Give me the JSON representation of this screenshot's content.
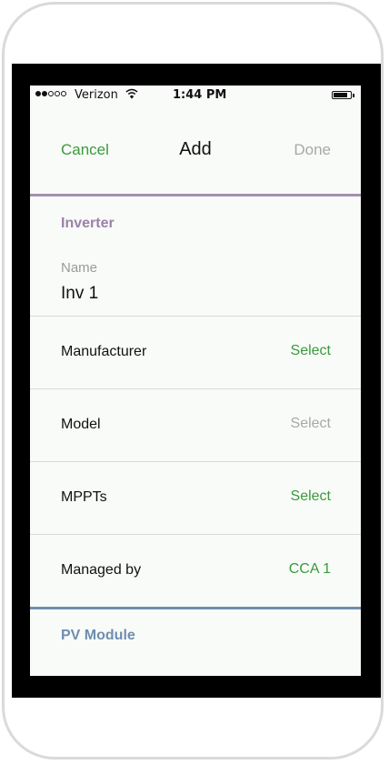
{
  "status_bar": {
    "carrier": "Verizon",
    "time": "1:44 PM",
    "signal_bars_filled": 2,
    "signal_bars_total": 5
  },
  "nav": {
    "cancel_label": "Cancel",
    "title": "Add",
    "done_label": "Done"
  },
  "inverter": {
    "section_title": "Inverter",
    "name_label": "Name",
    "name_value": "Inv 1",
    "rows": [
      {
        "label": "Manufacturer",
        "value": "Select",
        "value_state": "active"
      },
      {
        "label": "Model",
        "value": "Select",
        "value_state": "disabled"
      },
      {
        "label": "MPPTs",
        "value": "Select",
        "value_state": "active"
      },
      {
        "label": "Managed by",
        "value": "CCA 1",
        "value_state": "active"
      }
    ]
  },
  "pv_module": {
    "section_title": "PV Module"
  },
  "colors": {
    "accent_green": "#3a9a3a",
    "disabled_gray": "#a8a8a8",
    "inverter_purple": "#9a82a8",
    "pv_blue": "#6e8eaf"
  },
  "icons": {
    "wifi": "wifi-icon",
    "battery": "battery-icon",
    "signal": "signal-dots-icon"
  }
}
